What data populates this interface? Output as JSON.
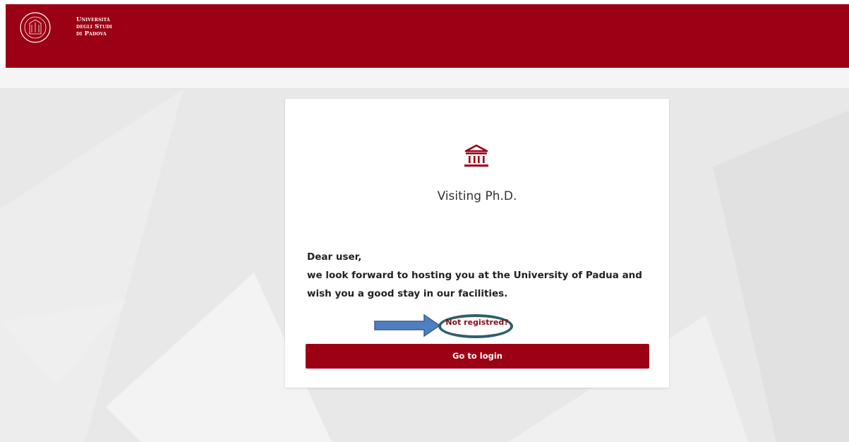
{
  "header": {
    "logo_line1": "Università",
    "logo_line2": "degli Studi",
    "logo_line3": "di Padova",
    "bg_color": "#9b0014"
  },
  "card": {
    "icon": "bank-icon",
    "title": "Visiting Ph.D.",
    "message": {
      "line1": "Dear user,",
      "line2": "we look forward to hosting you at the University of Padua and",
      "line3": "wish you a good stay in our facilities."
    },
    "not_registered_link": "Not registred?",
    "login_button": "Go to login"
  },
  "colors": {
    "accent": "#9b0014",
    "annotation_oval": "#2f5f6b",
    "annotation_arrow": "#4f7fbf"
  }
}
